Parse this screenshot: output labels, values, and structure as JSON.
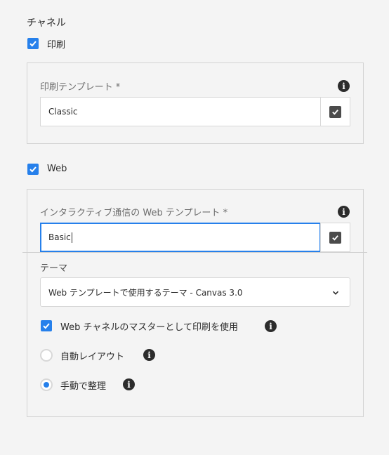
{
  "section_title": "チャネル",
  "print": {
    "checkbox_label": "印刷",
    "checked": true,
    "template_label": "印刷テンプレート *",
    "template_value": "Classic"
  },
  "web": {
    "checkbox_label": "Web",
    "checked": true,
    "template_label": "インタラクティブ通信の Web テンプレート *",
    "template_value": "Basic",
    "theme_label": "テーマ",
    "theme_value": "Web テンプレートで使用するテーマ - Canvas 3.0",
    "use_print_master_label": "Web チャネルのマスターとして印刷を使用",
    "use_print_master_checked": true,
    "layout_options": [
      {
        "label": "自動レイアウト",
        "selected": false
      },
      {
        "label": "手動で整理",
        "selected": true
      }
    ]
  },
  "colors": {
    "accent": "#2680eb",
    "text": "#2c2c2c",
    "muted": "#6e6e6e",
    "background": "#f4f4f4"
  },
  "icons": {
    "checkmark": "checkmark-icon",
    "info": "info-icon",
    "chevron": "chevron-down-icon",
    "edit": "checkbox-edit-icon"
  }
}
